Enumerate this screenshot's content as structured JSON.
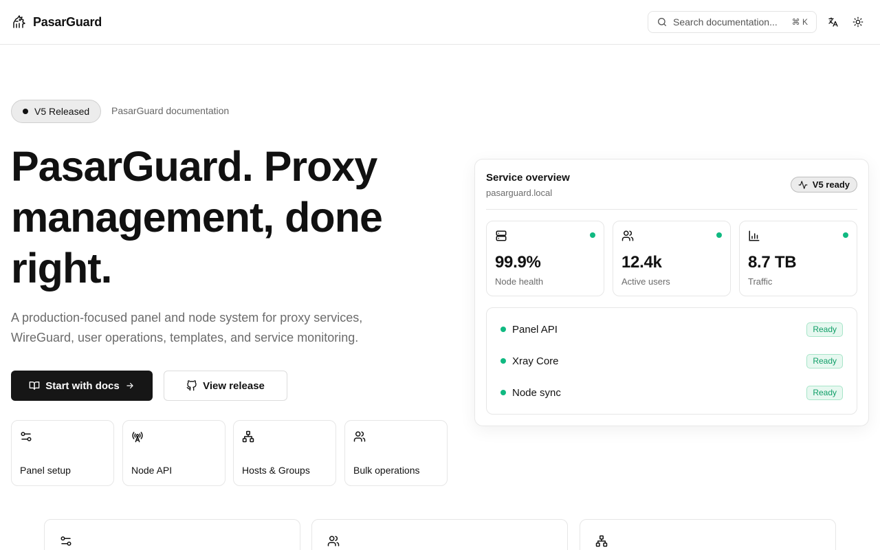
{
  "header": {
    "brand_name": "PasarGuard",
    "search_placeholder": "Search documentation...",
    "search_shortcut": "⌘ K",
    "icons": [
      "lion-logo-icon",
      "search-icon",
      "translate-icon",
      "sun-icon"
    ]
  },
  "hero": {
    "pill_label": "V5 Released",
    "pill_side": "PasarGuard documentation",
    "title": "PasarGuard. Proxy management, done right.",
    "subtitle": "A production-focused panel and node system for proxy services, WireGuard, user operations, templates, and service monitoring.",
    "primary_button": "Start with docs",
    "secondary_button": "View release"
  },
  "features": [
    {
      "label": "Panel setup",
      "icon": "sliders-icon"
    },
    {
      "label": "Node API",
      "icon": "radio-tower-icon"
    },
    {
      "label": "Hosts & Groups",
      "icon": "network-icon"
    },
    {
      "label": "Bulk operations",
      "icon": "users-icon"
    }
  ],
  "overview": {
    "title": "Service overview",
    "host": "pasarguard.local",
    "badge": "V5 ready",
    "stats": [
      {
        "value": "99.9%",
        "label": "Node health",
        "icon": "server-icon"
      },
      {
        "value": "12.4k",
        "label": "Active users",
        "icon": "users-icon"
      },
      {
        "value": "8.7 TB",
        "label": "Traffic",
        "icon": "bar-chart-icon"
      }
    ],
    "services": [
      {
        "name": "Panel API",
        "status": "Ready"
      },
      {
        "name": "Xray Core",
        "status": "Ready"
      },
      {
        "name": "Node sync",
        "status": "Ready"
      }
    ]
  },
  "colors": {
    "accent_green": "#10b981",
    "primary_button_bg": "#161616",
    "muted_text": "#6b6b6b"
  }
}
